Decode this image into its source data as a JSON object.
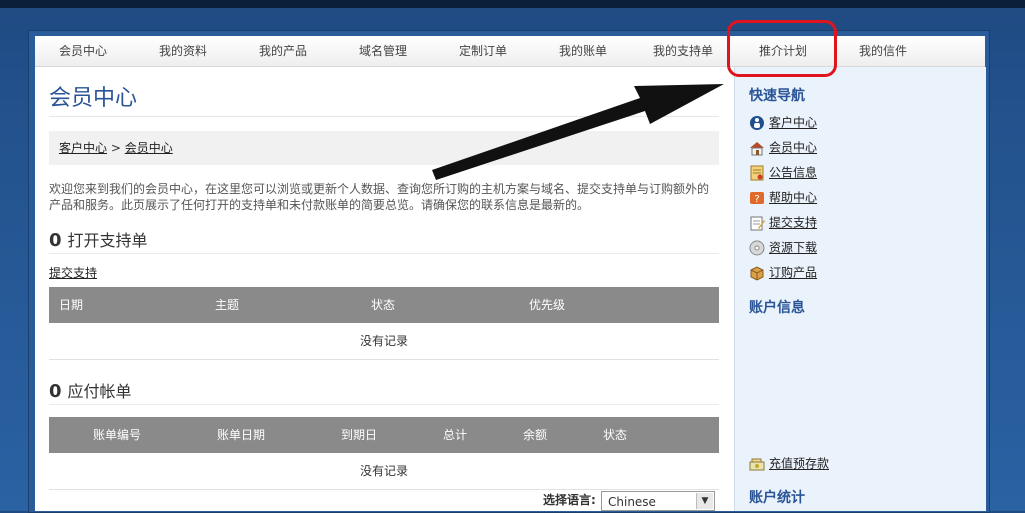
{
  "nav": [
    "会员中心",
    "我的资料",
    "我的产品",
    "域名管理",
    "定制订单",
    "我的账单",
    "我的支持单",
    "推介计划",
    "我的信件"
  ],
  "main": {
    "title": "会员中心",
    "crumb": {
      "root": "客户中心",
      "sep": ">",
      "current": "会员中心"
    },
    "welcome_line1": "欢迎您来到我们的会员中心，在这里您可以浏览或更新个人数据、查询您所订购的主机方案与域名、提交支持单与订购额外的",
    "welcome_line2": "产品和服务。此页展示了任何打开的支持单和未付款账单的简要总览。请确保您的联系信息是最新的。",
    "tickets": {
      "count": "0",
      "heading": "打开支持单",
      "link": "提交支持",
      "columns": [
        "日期",
        "主题",
        "状态",
        "优先级"
      ],
      "empty": "没有记录"
    },
    "invoices": {
      "count": "0",
      "heading": "应付帐单",
      "columns": [
        "账单编号",
        "账单日期",
        "到期日",
        "总计",
        "余额",
        "状态"
      ],
      "empty": "没有记录"
    },
    "language": {
      "label": "选择语言:",
      "value": "Chinese"
    }
  },
  "sidebar": {
    "quick_nav_title": "快速导航",
    "links": [
      "客户中心",
      "会员中心",
      "公告信息",
      "帮助中心",
      "提交支持",
      "资源下载",
      "订购产品"
    ],
    "account_info_title": "账户信息",
    "recharge": "充值预存款",
    "account_stats_title": "账户统计"
  },
  "colors": {
    "accent": "#2a5496",
    "highlight": "#e0141c"
  }
}
